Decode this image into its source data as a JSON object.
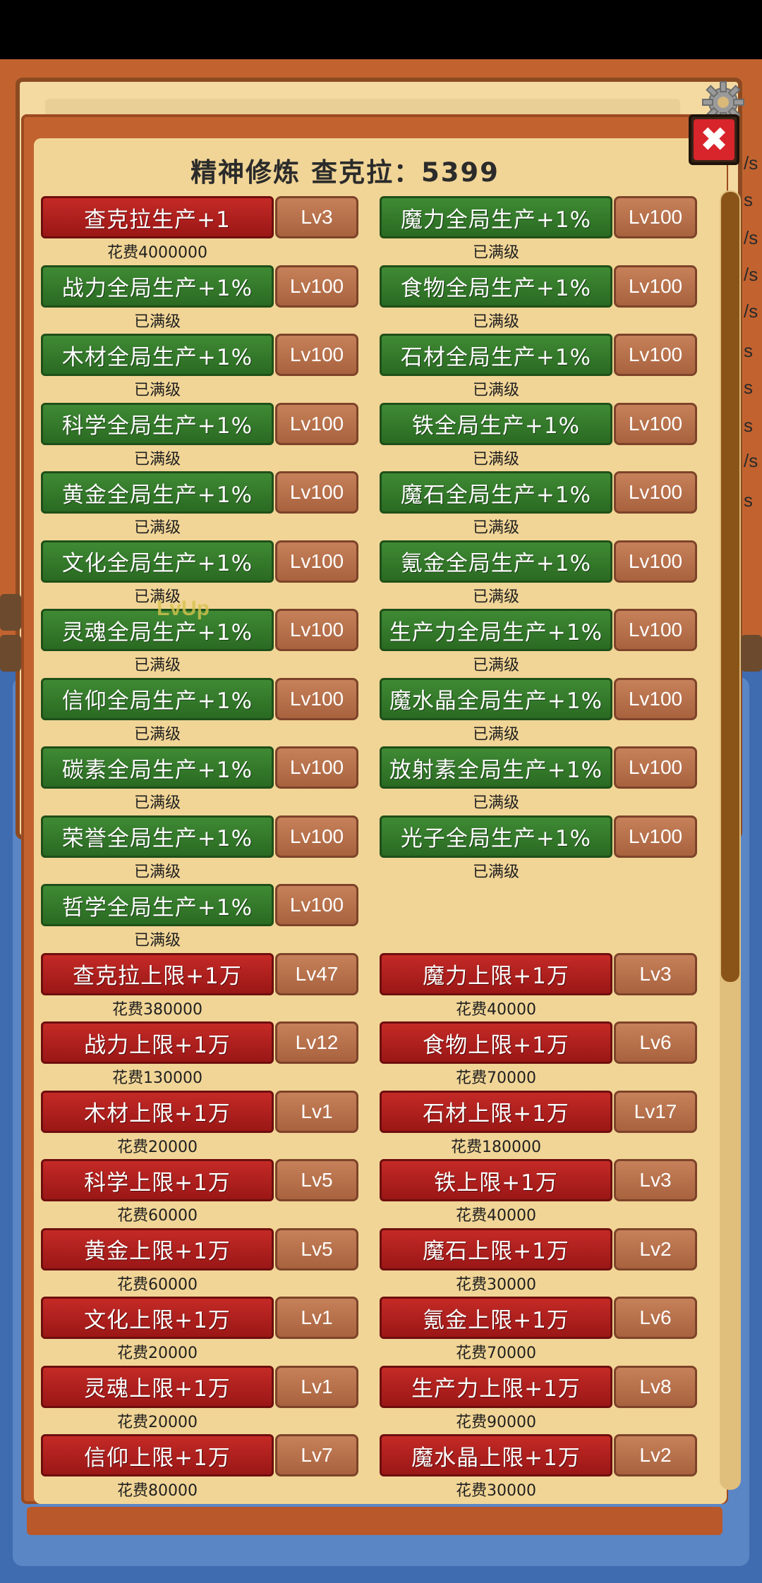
{
  "panel": {
    "title": "精神修炼 查克拉：5399",
    "close_label": "✖"
  },
  "overlay": {
    "lvup": "LvUp"
  },
  "background": {
    "edge_letters": [
      "/s",
      "s",
      "/s",
      "/s",
      "/s",
      "s",
      "s",
      "s",
      "/s",
      "s"
    ]
  },
  "upgrades_left": [
    {
      "name": "查克拉生产+1",
      "level": "Lv3",
      "note": "花费4000000",
      "style": "red"
    },
    {
      "name": "战力全局生产+1%",
      "level": "Lv100",
      "note": "已满级",
      "style": "green"
    },
    {
      "name": "木材全局生产+1%",
      "level": "Lv100",
      "note": "已满级",
      "style": "green"
    },
    {
      "name": "科学全局生产+1%",
      "level": "Lv100",
      "note": "已满级",
      "style": "green"
    },
    {
      "name": "黄金全局生产+1%",
      "level": "Lv100",
      "note": "已满级",
      "style": "green"
    },
    {
      "name": "文化全局生产+1%",
      "level": "Lv100",
      "note": "已满级",
      "style": "green"
    },
    {
      "name": "灵魂全局生产+1%",
      "level": "Lv100",
      "note": "已满级",
      "style": "green"
    },
    {
      "name": "信仰全局生产+1%",
      "level": "Lv100",
      "note": "已满级",
      "style": "green"
    },
    {
      "name": "碳素全局生产+1%",
      "level": "Lv100",
      "note": "已满级",
      "style": "green"
    },
    {
      "name": "荣誉全局生产+1%",
      "level": "Lv100",
      "note": "已满级",
      "style": "green"
    },
    {
      "name": "哲学全局生产+1%",
      "level": "Lv100",
      "note": "已满级",
      "style": "green"
    },
    {
      "name": "查克拉上限+1万",
      "level": "Lv47",
      "note": "花费380000",
      "style": "red"
    },
    {
      "name": "战力上限+1万",
      "level": "Lv12",
      "note": "花费130000",
      "style": "red"
    },
    {
      "name": "木材上限+1万",
      "level": "Lv1",
      "note": "花费20000",
      "style": "red"
    },
    {
      "name": "科学上限+1万",
      "level": "Lv5",
      "note": "花费60000",
      "style": "red"
    },
    {
      "name": "黄金上限+1万",
      "level": "Lv5",
      "note": "花费60000",
      "style": "red"
    },
    {
      "name": "文化上限+1万",
      "level": "Lv1",
      "note": "花费20000",
      "style": "red"
    },
    {
      "name": "灵魂上限+1万",
      "level": "Lv1",
      "note": "花费20000",
      "style": "red"
    },
    {
      "name": "信仰上限+1万",
      "level": "Lv7",
      "note": "花费80000",
      "style": "red"
    }
  ],
  "upgrades_right": [
    {
      "name": "魔力全局生产+1%",
      "level": "Lv100",
      "note": "已满级",
      "style": "green"
    },
    {
      "name": "食物全局生产+1%",
      "level": "Lv100",
      "note": "已满级",
      "style": "green"
    },
    {
      "name": "石材全局生产+1%",
      "level": "Lv100",
      "note": "已满级",
      "style": "green"
    },
    {
      "name": "铁全局生产+1%",
      "level": "Lv100",
      "note": "已满级",
      "style": "green"
    },
    {
      "name": "魔石全局生产+1%",
      "level": "Lv100",
      "note": "已满级",
      "style": "green"
    },
    {
      "name": "氪金全局生产+1%",
      "level": "Lv100",
      "note": "已满级",
      "style": "green"
    },
    {
      "name": "生产力全局生产+1%",
      "level": "Lv100",
      "note": "已满级",
      "style": "green"
    },
    {
      "name": "魔水晶全局生产+1%",
      "level": "Lv100",
      "note": "已满级",
      "style": "green"
    },
    {
      "name": "放射素全局生产+1%",
      "level": "Lv100",
      "note": "已满级",
      "style": "green"
    },
    {
      "name": "光子全局生产+1%",
      "level": "Lv100",
      "note": "已满级",
      "style": "green"
    },
    null,
    {
      "name": "魔力上限+1万",
      "level": "Lv3",
      "note": "花费40000",
      "style": "red"
    },
    {
      "name": "食物上限+1万",
      "level": "Lv6",
      "note": "花费70000",
      "style": "red"
    },
    {
      "name": "石材上限+1万",
      "level": "Lv17",
      "note": "花费180000",
      "style": "red"
    },
    {
      "name": "铁上限+1万",
      "level": "Lv3",
      "note": "花费40000",
      "style": "red"
    },
    {
      "name": "魔石上限+1万",
      "level": "Lv2",
      "note": "花费30000",
      "style": "red"
    },
    {
      "name": "氪金上限+1万",
      "level": "Lv6",
      "note": "花费70000",
      "style": "red"
    },
    {
      "name": "生产力上限+1万",
      "level": "Lv8",
      "note": "花费90000",
      "style": "red"
    },
    {
      "name": "魔水晶上限+1万",
      "level": "Lv2",
      "note": "花费30000",
      "style": "red"
    }
  ],
  "colors": {
    "green_button": "#2f7a28",
    "red_button": "#b0201e",
    "level_button": "#b56c48",
    "parchment": "#f1d596",
    "frame_orange": "#c2632f",
    "frame_blue": "#3f6bb0"
  }
}
